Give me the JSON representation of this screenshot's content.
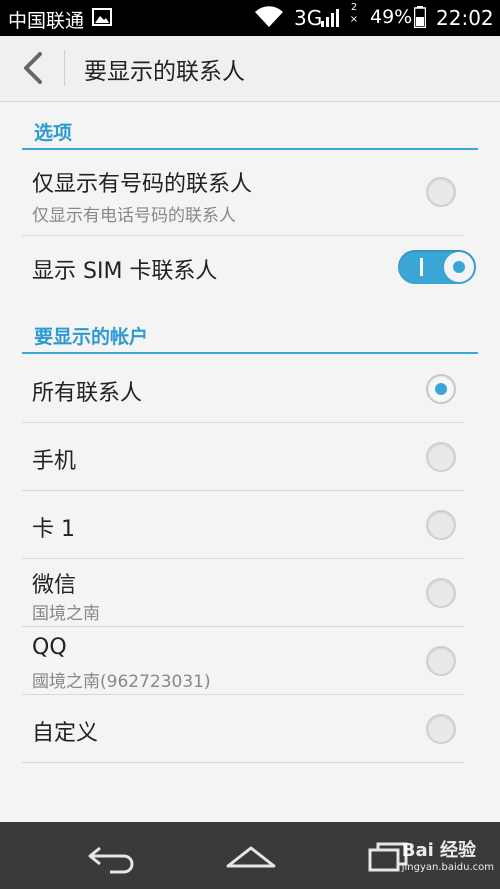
{
  "status_bar": {
    "carrier": "中国联通",
    "network": "3G",
    "sim2": "2",
    "battery": "49%",
    "time": "22:02",
    "icons": [
      "picture-icon",
      "wifi-icon",
      "signal-icon",
      "battery-icon"
    ]
  },
  "app_bar": {
    "title": "要显示的联系人",
    "back_icon": "chevron-left-icon"
  },
  "sections": {
    "options": {
      "header": "选项",
      "only_with_number": {
        "label": "仅显示有号码的联系人",
        "sub": "仅显示有电话号码的联系人",
        "checked": false
      },
      "show_sim": {
        "label": "显示 SIM 卡联系人",
        "on": true
      }
    },
    "accounts": {
      "header": "要显示的帐户",
      "items": [
        {
          "label": "所有联系人",
          "sub": "",
          "checked": true
        },
        {
          "label": "手机",
          "sub": "",
          "checked": false
        },
        {
          "label": "卡 1",
          "sub": "",
          "checked": false
        },
        {
          "label": "微信",
          "sub": "国境之南",
          "checked": false
        },
        {
          "label": "QQ",
          "sub": "國境之南(962723031)",
          "checked": false
        },
        {
          "label": "自定义",
          "sub": "",
          "checked": false
        }
      ]
    }
  },
  "nav_bar": {
    "buttons": [
      "back-icon",
      "home-icon",
      "recent-apps-icon"
    ]
  },
  "watermark": {
    "brand": "Bai 经验",
    "url": "jingyan.baidu.com"
  },
  "colors": {
    "accent": "#3aa6d6",
    "status_bar": "#000000",
    "nav_bar": "#3a3a3a"
  }
}
